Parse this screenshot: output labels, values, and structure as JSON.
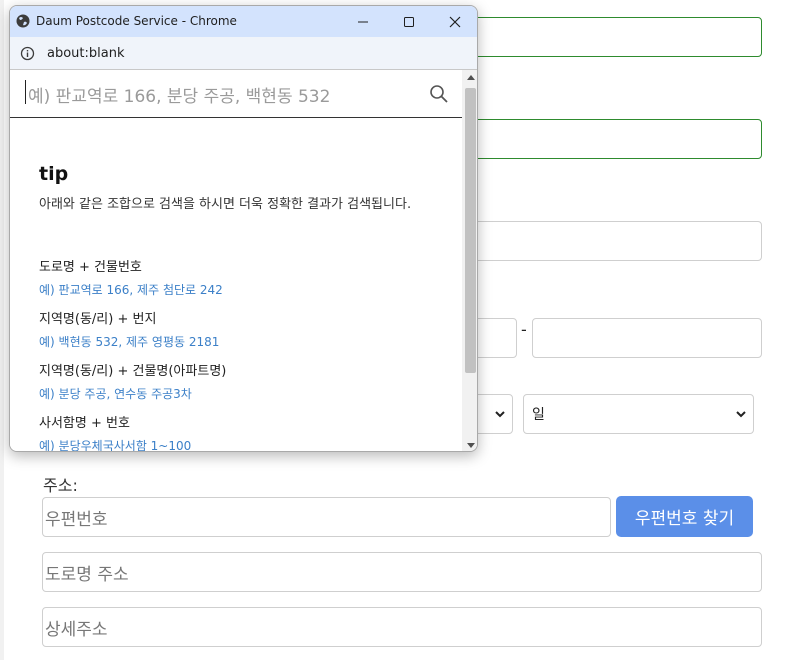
{
  "form": {
    "address_label": "주소:",
    "postcode_placeholder": "우편번호",
    "postcode_button": "우편번호 찾기",
    "road_address_placeholder": "도로명 주소",
    "detail_address_placeholder": "상세주소",
    "phone_separator": "-",
    "day_select": "일"
  },
  "popup": {
    "window_title": "Daum Postcode Service - Chrome",
    "url": "about:blank",
    "search": {
      "placeholder": "예) 판교역로 166, 분당 주공, 백현동 532"
    },
    "tip": {
      "title": "tip",
      "description": "아래와 같은 조합으로 검색을 하시면 더욱 정확한 결과가 검색됩니다.",
      "examples": [
        {
          "head": "도로명 + 건물번호",
          "body": "예) 판교역로 166,  제주 첨단로 242"
        },
        {
          "head": "지역명(동/리) + 번지",
          "body": "예) 백현동 532,  제주 영평동 2181"
        },
        {
          "head": "지역명(동/리) + 건물명(아파트명)",
          "body": "예) 분당 주공,  연수동 주공3차"
        },
        {
          "head": "사서함명 + 번호",
          "body": "예) 분당우체국사서함 1~100"
        }
      ]
    }
  },
  "colors": {
    "accent_button": "#5b8fe8",
    "valid_border": "#2e8b2e",
    "titlebar": "#d3e3fd",
    "example_link": "#3c80c8"
  }
}
